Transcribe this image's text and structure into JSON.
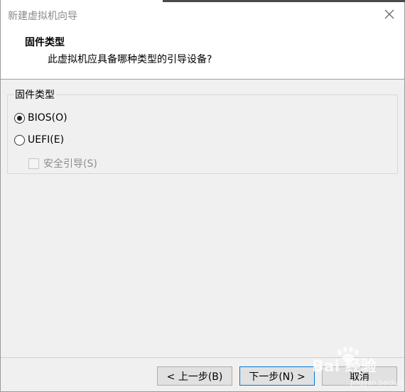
{
  "window": {
    "title": "新建虚拟机向导",
    "close_icon": "close-icon"
  },
  "header": {
    "title": "固件类型",
    "description": "此虚拟机应具备哪种类型的引导设备?"
  },
  "firmware_group": {
    "legend": "固件类型",
    "options": [
      {
        "label": "BIOS(O)",
        "selected": true
      },
      {
        "label": "UEFI(E)",
        "selected": false
      }
    ],
    "secure_boot": {
      "label": "安全引导(S)",
      "checked": false,
      "enabled": false
    }
  },
  "footer": {
    "back_label": "< 上一步(B)",
    "next_label": "下一步(N) >",
    "cancel_label": "取消"
  },
  "watermark": {
    "text": "Bai 经验",
    "url": "jingyan.baidu.com"
  },
  "colors": {
    "dialog_bg": "#f0f0f0",
    "header_bg": "#ffffff",
    "focus_border": "#0078d7",
    "disabled_text": "#8d8d8d"
  }
}
